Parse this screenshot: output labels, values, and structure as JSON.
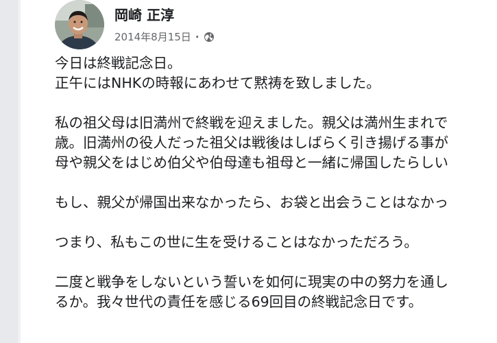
{
  "post": {
    "author": "岡崎 正淳",
    "date": "2014年8月15日",
    "separator": "·",
    "privacy_icon": "globe-icon",
    "paragraphs": [
      [
        "今日は終戦記念日。",
        "正午にはNHKの時報にあわせて黙祷を致しました。"
      ],
      [
        "私の祖父母は旧満州で終戦を迎えました。親父は満州生まれで",
        "歳。旧満州の役人だった祖父は戦後はしばらく引き揚げる事が",
        "母や親父をはじめ伯父や伯母達も祖母と一緒に帰国したらしい"
      ],
      [
        "もし、親父が帰国出来なかったら、お袋と出会うことはなかっ"
      ],
      [
        "つまり、私もこの世に生を受けることはなかっただろう。"
      ],
      [
        "二度と戦争をしないという誓いを如何に現実の中の努力を通し",
        "るか。我々世代の責任を感じる69回目の終戦記念日です。"
      ]
    ]
  }
}
